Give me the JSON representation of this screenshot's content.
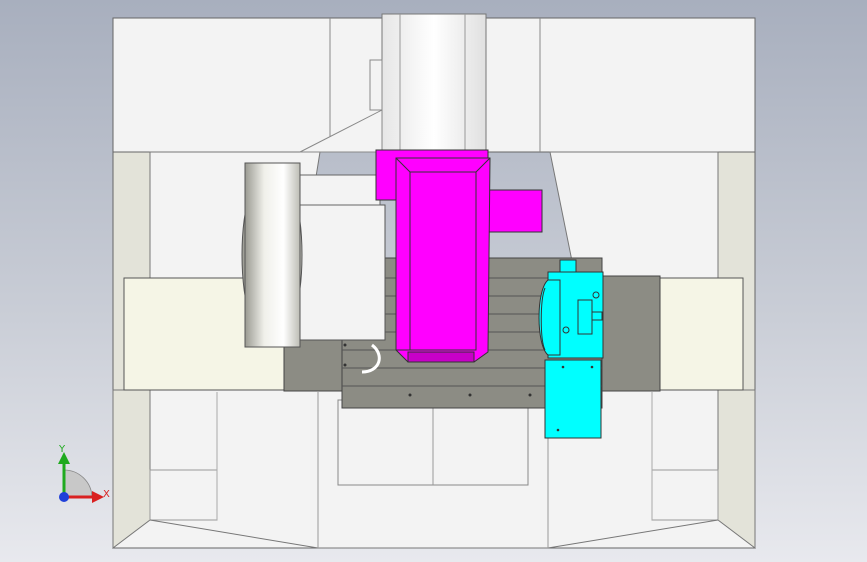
{
  "viewport": {
    "background_top": "#a8afbe",
    "background_bottom": "#e8e9ee"
  },
  "colors": {
    "enclosure": "#f3f3f3",
    "enclosure_shadow": "#e3e3d9",
    "outline": "#555555",
    "table": "#8c8c84",
    "table_dark": "#6f6f68",
    "spindle_head": "#ff00ff",
    "spindle_head_shade": "#c800c8",
    "rotary_unit": "#00ffff",
    "rotary_unit_shade": "#00b8c8",
    "motor_gray": "#d8d8d2",
    "axis_x": "#d92020",
    "axis_y": "#1faa1f",
    "axis_z": "#1f3fd9"
  },
  "triad": {
    "y_label": "Y",
    "x_label": "X"
  }
}
